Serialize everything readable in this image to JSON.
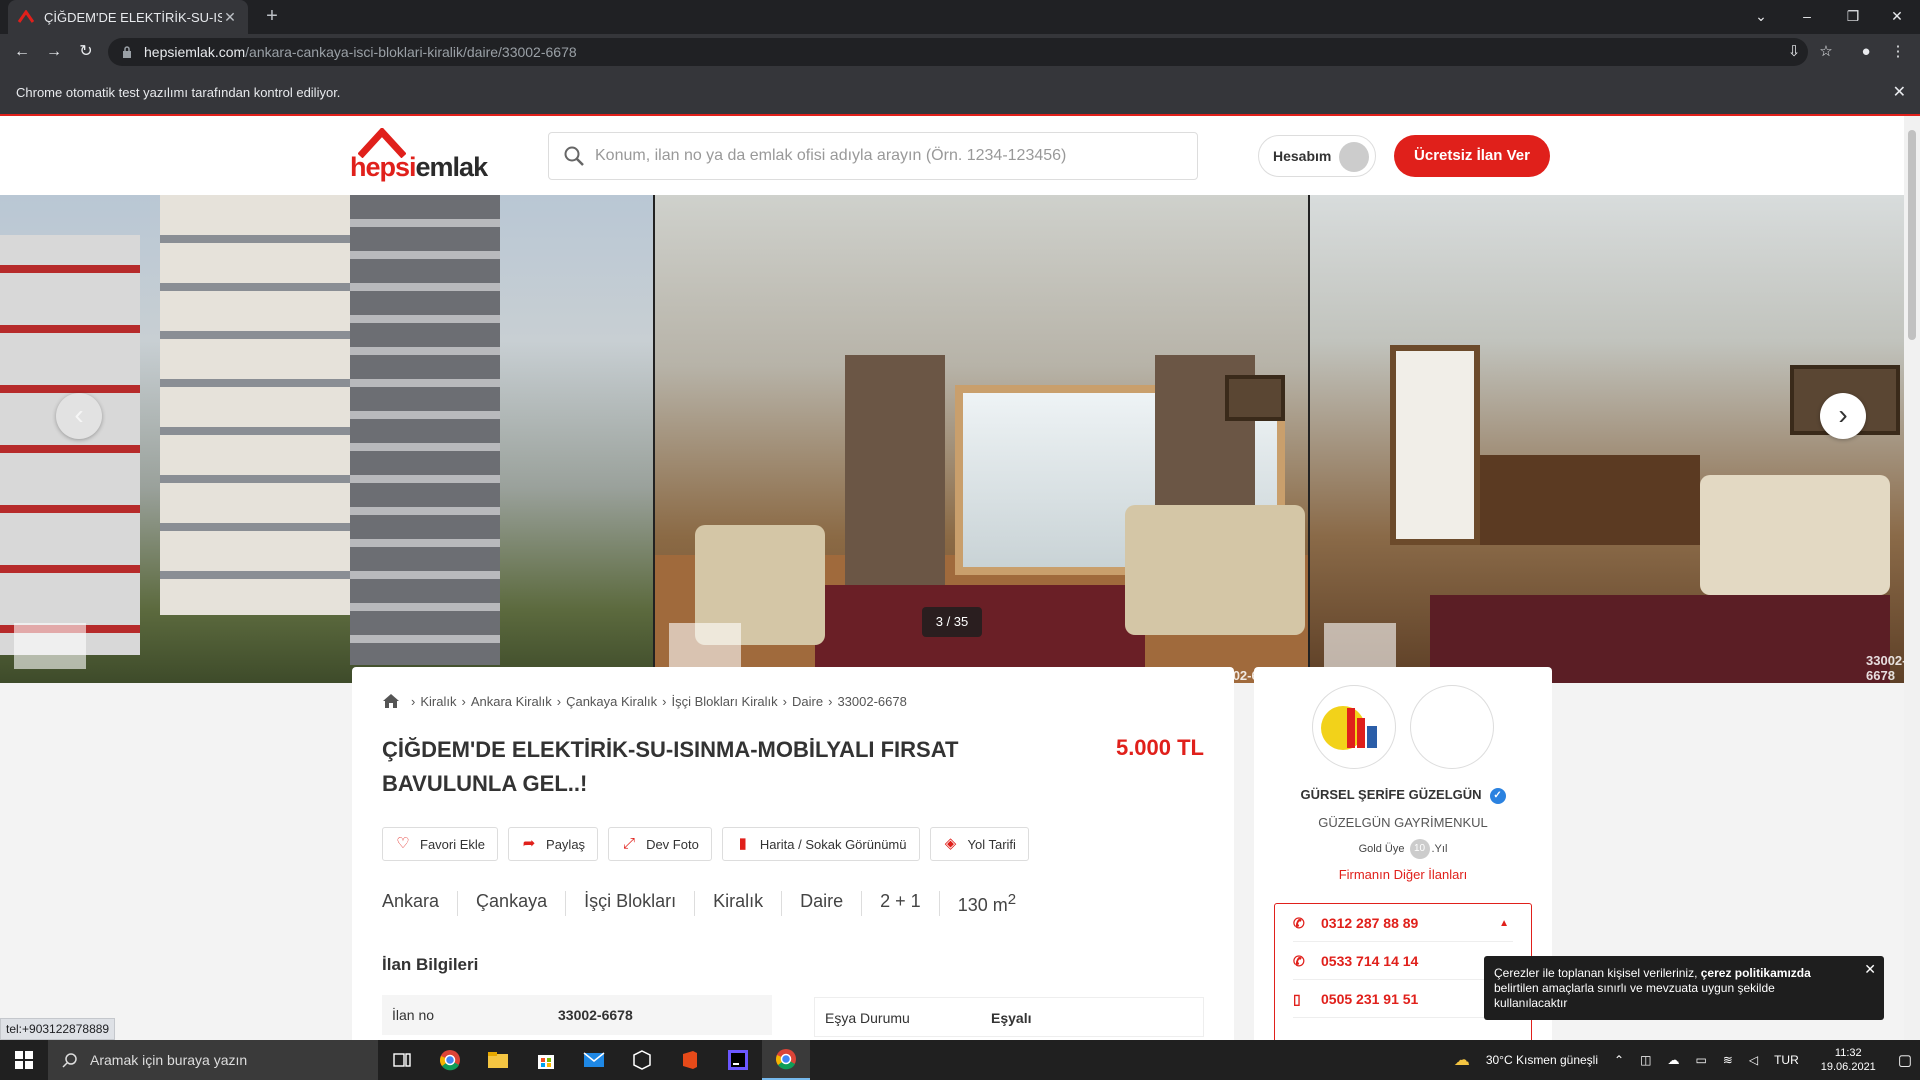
{
  "browser": {
    "tab_title": "ÇİĞDEM'DE ELEKTİRİK-SU-ISINMA",
    "url_domain": "hepsiemlak.com",
    "url_path": "/ankara-cankaya-isci-bloklari-kiralik/daire/33002-6678",
    "infobar_text": "Chrome otomatik test yazılımı tarafından kontrol ediliyor."
  },
  "header": {
    "logo_part1": "hepsi",
    "logo_part2": "emlak",
    "search_placeholder": "Konum, ilan no ya da emlak ofisi adıyla arayın (Örn. 1234-123456)",
    "account_label": "Hesabım",
    "cta_label": "Ücretsiz İlan Ver"
  },
  "gallery": {
    "counter": "3 / 35",
    "watermark": "33002-6678"
  },
  "listing": {
    "breadcrumbs": [
      "Kiralık",
      "Ankara Kiralık",
      "Çankaya Kiralık",
      "İşçi Blokları Kiralık",
      "Daire",
      "33002-6678"
    ],
    "title": "ÇİĞDEM'DE ELEKTİRİK-SU-ISINMA-MOBİLYALI FIRSAT BAVULUNLA GEL..!",
    "price": "5.000 TL",
    "actions": {
      "favorite": "Favori Ekle",
      "share": "Paylaş",
      "big_photo": "Dev Foto",
      "map": "Harita / Sokak Görünümü",
      "directions": "Yol Tarifi"
    },
    "features": [
      "Ankara",
      "Çankaya",
      "İşçi Blokları",
      "Kiralık",
      "Daire",
      "2 + 1"
    ],
    "area_value": "130 m",
    "area_sup": "2",
    "section_title": "İlan Bilgileri",
    "info_rows": [
      {
        "key": "İlan no",
        "value": "33002-6678"
      },
      {
        "key": "Eşya Durumu",
        "value": "Eşyalı"
      }
    ]
  },
  "agent": {
    "name": "GÜRSEL ŞERİFE GÜZELGÜN",
    "firm": "GÜZELGÜN GAYRİMENKUL",
    "member_prefix": "Gold Üye",
    "member_years": "10",
    "member_suffix": ".Yıl",
    "other_listings": "Firmanın Diğer İlanları",
    "phones": [
      "0312 287 88 89",
      "0533 714 14 14",
      "0505 231 91 51"
    ]
  },
  "cookie": {
    "text_pre": "Çerezler ile toplanan kişisel verileriniz, ",
    "text_bold": "çerez politikamızda",
    "text_post": " belirtilen amaçlarla sınırlı ve mevzuata uygun şekilde kullanılacaktır"
  },
  "statusbar": {
    "link": "tel:+903122878889"
  },
  "taskbar": {
    "search_placeholder": "Aramak için buraya yazın",
    "weather": "30°C  Kısmen güneşli",
    "lang": "TUR",
    "time": "11:32",
    "date": "19.06.2021"
  },
  "colors": {
    "brand_red": "#e0201b",
    "verified_blue": "#2b82e0"
  }
}
